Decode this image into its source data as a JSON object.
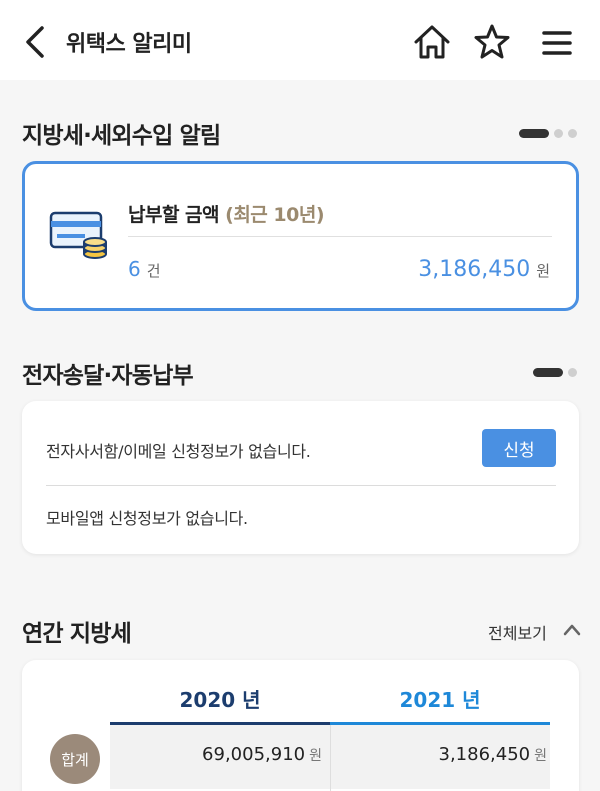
{
  "header": {
    "title": "위택스 알리미"
  },
  "sections": {
    "notice": {
      "title": "지방세·세외수입 알림",
      "label": "납부할 금액",
      "label_sub": "(최근 10년)",
      "count": "6",
      "count_unit": "건",
      "amount": "3,186,450",
      "amount_unit": "원"
    },
    "service": {
      "title": "전자송달·자동납부",
      "email_status": "전자사서함/이메일 신청정보가 없습니다.",
      "apply_label": "신청",
      "mobile_status": "모바일앱 신청정보가 없습니다."
    },
    "annual": {
      "title": "연간 지방세",
      "view_all": "전체보기",
      "years": [
        "2020 년",
        "2021 년"
      ],
      "total_label": "합계",
      "totals": [
        {
          "value": "69,005,910",
          "unit": "원"
        },
        {
          "value": "3,186,450",
          "unit": "원"
        }
      ]
    }
  },
  "colors": {
    "accent": "#4a90e2",
    "year_2020": "#1c3d6e",
    "year_2021": "#1e88d8",
    "badge": "#9b8a7a"
  }
}
